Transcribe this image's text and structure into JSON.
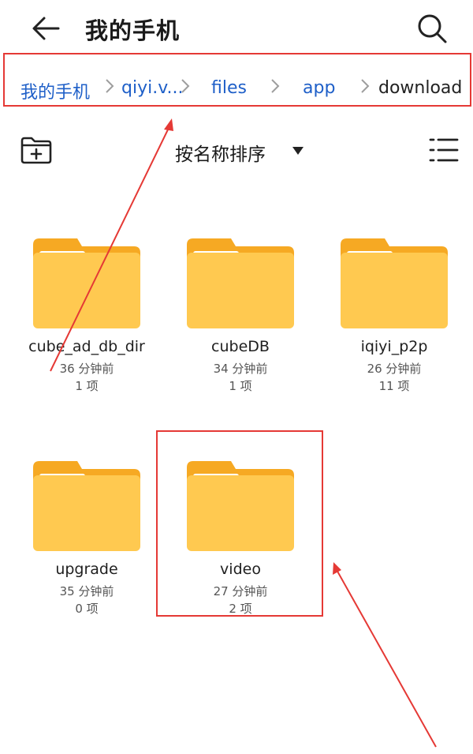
{
  "header": {
    "title": "我的手机",
    "back_icon": "arrow-left-icon",
    "search_icon": "search-icon"
  },
  "breadcrumb": {
    "items": [
      {
        "label": "我的手机"
      },
      {
        "label": "qiyi.v..."
      },
      {
        "label": "files"
      },
      {
        "label": "app"
      },
      {
        "label": "download"
      }
    ],
    "link_color": "#1e5fc8",
    "separator_icon": "chevron-right-icon"
  },
  "toolbar": {
    "sort_label": "按名称排序",
    "new_folder_icon": "new-folder-icon",
    "view_icon": "list-view-icon"
  },
  "folders": [
    {
      "name": "cube_ad_db_dir",
      "modified": "36 分钟前",
      "count": "1 项"
    },
    {
      "name": "cubeDB",
      "modified": "34 分钟前",
      "count": "1 项"
    },
    {
      "name": "iqiyi_p2p",
      "modified": "26 分钟前",
      "count": "11 项"
    },
    {
      "name": "upgrade",
      "modified": "35 分钟前",
      "count": "0 项"
    },
    {
      "name": "video",
      "modified": "27 分钟前",
      "count": "2 项"
    }
  ],
  "colors": {
    "folder_body": "#FFC950",
    "folder_tab": "#F6A923",
    "annotation": "#e53935"
  }
}
